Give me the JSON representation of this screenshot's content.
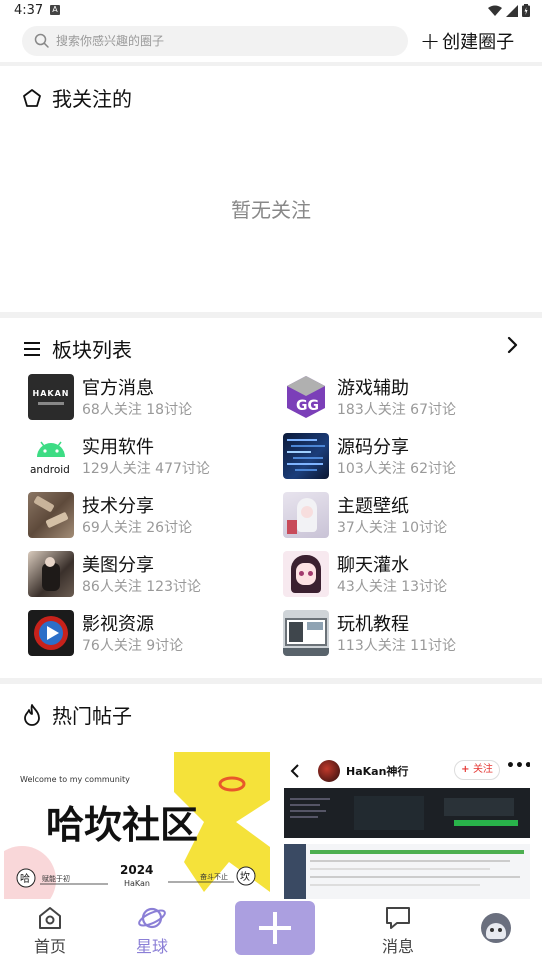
{
  "status_bar": {
    "time": "4:37",
    "badge": "A"
  },
  "search": {
    "placeholder": "搜索你感兴趣的圈子"
  },
  "create": {
    "label": "创建圈子"
  },
  "following": {
    "title": "我关注的",
    "empty": "暂无关注"
  },
  "boards": {
    "title": "板块列表",
    "items": [
      {
        "name": "官方消息",
        "stats": "68人关注 18讨论",
        "thumb_label": "HAKAN"
      },
      {
        "name": "游戏辅助",
        "stats": "183人关注 67讨论",
        "thumb_label": "GG"
      },
      {
        "name": "实用软件",
        "stats": "129人关注 477讨论",
        "thumb_label": "android"
      },
      {
        "name": "源码分享",
        "stats": "103人关注 62讨论"
      },
      {
        "name": "技术分享",
        "stats": "69人关注 26讨论"
      },
      {
        "name": "主题壁纸",
        "stats": "37人关注 10讨论"
      },
      {
        "name": "美图分享",
        "stats": "86人关注 123讨论"
      },
      {
        "name": "聊天灌水",
        "stats": "43人关注 13讨论"
      },
      {
        "name": "影视资源",
        "stats": "76人关注 9讨论"
      },
      {
        "name": "玩机教程",
        "stats": "113人关注 11讨论"
      }
    ]
  },
  "hot": {
    "title": "热门帖子",
    "post1": {
      "welcome": "Welcome to my community",
      "headline": "哈坎社区",
      "year": "2024",
      "brand": "HaKan",
      "left_char": "哈",
      "right_char": "坎",
      "left_motto": "赋能于初",
      "right_motto": "奋斗不止"
    },
    "post2": {
      "author": "HaKan神行",
      "follow": "关注"
    }
  },
  "tabs": [
    {
      "label": "首页",
      "icon": "home-icon"
    },
    {
      "label": "星球",
      "icon": "planet-icon"
    },
    {
      "label": "",
      "icon": "plus-icon"
    },
    {
      "label": "消息",
      "icon": "message-icon"
    },
    {
      "label": "",
      "icon": "avatar"
    }
  ],
  "colors": {
    "accent": "#8b7fd6",
    "fab": "#ab9fe0",
    "follow_red": "#e53935"
  }
}
